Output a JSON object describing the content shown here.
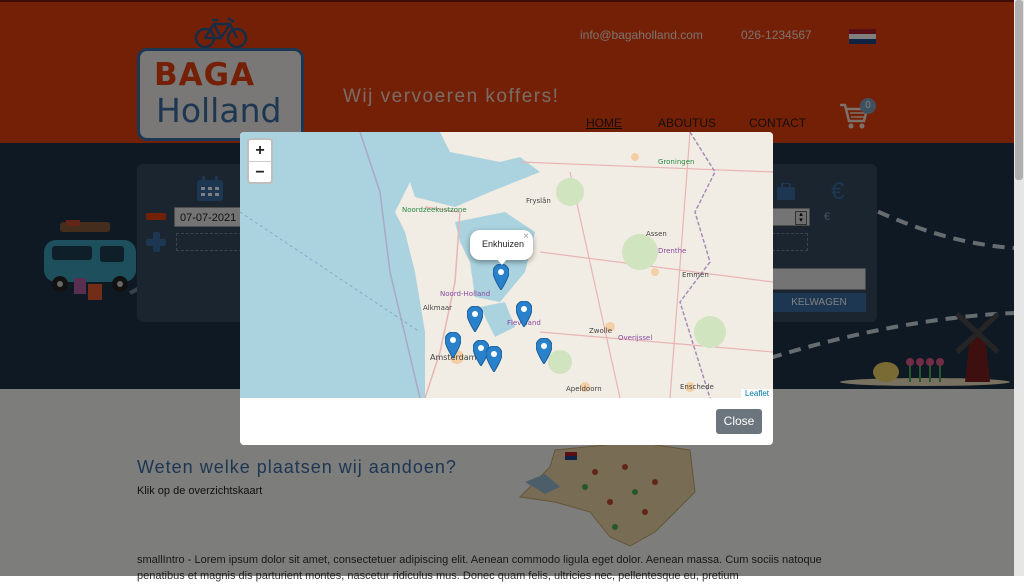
{
  "header": {
    "logo_line1": "BAGA",
    "logo_line2": "Holland",
    "tagline": "Wij vervoeren koffers!",
    "email": "info@bagaholland.com",
    "phone": "026-1234567",
    "language_flag": "dutch-flag-icon",
    "nav": [
      {
        "label": "HOME",
        "active": true
      },
      {
        "label": "ABOUTUS",
        "active": false
      },
      {
        "label": "CONTACT",
        "active": false
      }
    ],
    "cart_count": "0"
  },
  "booking": {
    "date_value": "07-07-2021",
    "currency_symbol": "€",
    "currency_small": "€",
    "add_to_cart_label": "KELWAGEN"
  },
  "content": {
    "heading": "Weten welke plaatsen wij aandoen?",
    "subtext": "Klik op de overzichtskaart",
    "intro": "smallIntro - Lorem ipsum dolor sit amet, consectetuer adipiscing elit. Aenean commodo ligula eget dolor. Aenean massa. Cum sociis natoque penatibus et magnis dis parturient montes, nascetur ridiculus mus. Donec quam felis, ultricies nec, pellentesque eu, pretium"
  },
  "modal": {
    "zoom_in": "+",
    "zoom_out": "−",
    "popup_label": "Enkhuizen",
    "popup_close": "×",
    "attribution": "Leaflet",
    "close_label": "Close",
    "map_labels": [
      "Noordzeekustzone",
      "Fryslân",
      "Groningen",
      "Assen",
      "Drenthe",
      "Emmen",
      "Noord-Holland",
      "Alkmaar",
      "Flevoland",
      "Zwolle",
      "Overijssel",
      "Amsterdam",
      "Apeldoorn",
      "Enschede"
    ]
  },
  "colors": {
    "header_orange": "#e8410f",
    "brand_blue": "#3b6ea5",
    "marker_blue": "#2a81cb",
    "close_gray": "#6c757d"
  }
}
